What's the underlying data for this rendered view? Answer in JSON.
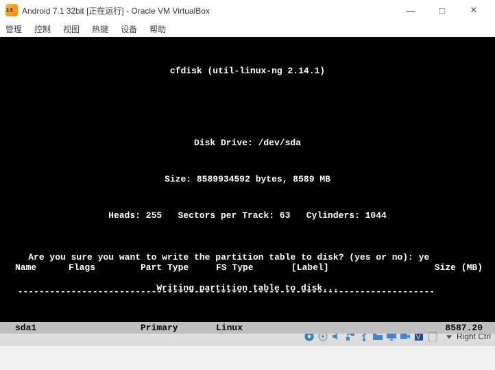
{
  "window": {
    "title": "Android 7.1 32bit [正在运行] - Oracle VM VirtualBox"
  },
  "menu": {
    "manage": "管理",
    "control": "控制",
    "view": "视图",
    "hotkey": "热键",
    "devices": "设备",
    "help": "帮助"
  },
  "console": {
    "program": "cfdisk (util-linux-ng 2.14.1)",
    "drive": "Disk Drive: /dev/sda",
    "size": "Size: 8589934592 bytes, 8589 MB",
    "geometry": "Heads: 255   Sectors per Track: 63   Cylinders: 1044",
    "headers": {
      "name": "Name",
      "flags": "Flags",
      "parttype": "Part Type",
      "fstype": "FS Type",
      "label": "[Label]",
      "size": "Size (MB)"
    },
    "dashes": "------------------------------------------------------------------------------",
    "row": {
      "name": "sda1",
      "flags": "",
      "parttype": "Primary",
      "fstype": "Linux",
      "label": "",
      "size": "8587.20"
    },
    "prompt": "Are you sure you want to write the partition table to disk? (yes or no): ye",
    "writing": "Writing partition table to disk..."
  },
  "status": {
    "hostkey": "Right Ctrl"
  }
}
